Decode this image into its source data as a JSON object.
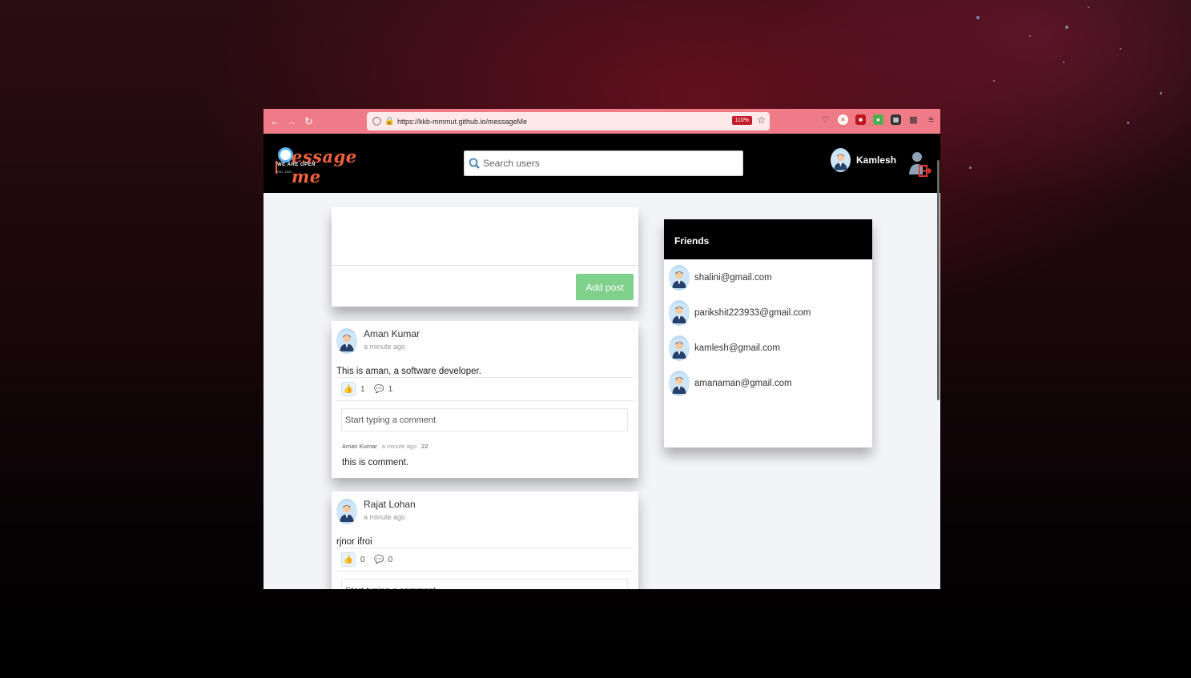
{
  "browser": {
    "url": "https://kkb-mmmut.github.io/messageMe",
    "zoom": "110%"
  },
  "app": {
    "logo_title": "essage me",
    "logo_subtitle": "WE ARE OPEN",
    "logo_est": "EST. 2021"
  },
  "header": {
    "search_placeholder": "Search users",
    "user_name": "Kamlesh"
  },
  "composer": {
    "add_post_label": "Add post"
  },
  "posts": [
    {
      "author": "Aman Kumar",
      "time": "a minute ago",
      "text": "This is aman, a software developer.",
      "likes": "1",
      "comments_count": "1",
      "comment_placeholder": "Start typing a comment",
      "comments": [
        {
          "author": "Aman Kumar",
          "time": "a minute ago",
          "id": "22",
          "text": "this is comment."
        }
      ]
    },
    {
      "author": "Rajat Lohan",
      "time": "a minute ago",
      "text": "rjnor ifroi",
      "likes": "0",
      "comments_count": "0",
      "comment_placeholder": "Start typing a comment"
    }
  ],
  "friends": {
    "title": "Friends",
    "items": [
      "shalini@gmail.com",
      "parikshit223933@gmail.com",
      "kamlesh@gmail.com",
      "amanaman@gmail.com"
    ]
  },
  "colors": {
    "toolbar": "#ef7b86",
    "accent_green": "#7fd08a",
    "logo_orange": "#f2623f"
  }
}
